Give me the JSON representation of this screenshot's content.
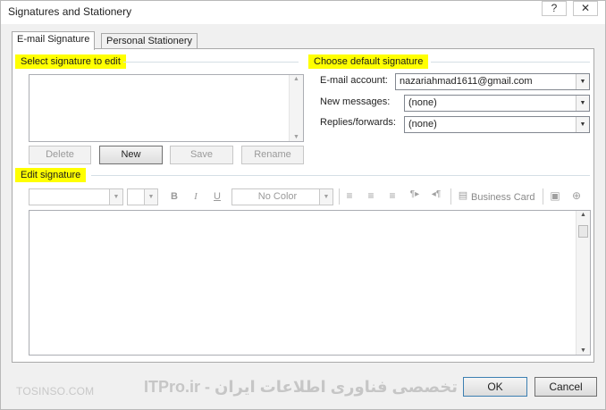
{
  "window": {
    "title": "Signatures and Stationery",
    "help_glyph": "?",
    "close_glyph": "✕"
  },
  "tabs": [
    {
      "label": "E-mail Signature",
      "active": true
    },
    {
      "label": "Personal Stationery",
      "active": false
    }
  ],
  "select_section": {
    "heading": "Select signature to edit",
    "buttons": {
      "delete": "Delete",
      "new": "New",
      "save": "Save",
      "rename": "Rename"
    }
  },
  "default_section": {
    "heading": "Choose default signature",
    "email_account_label": "E-mail account:",
    "email_account_value": "nazariahmad1611@gmail.com",
    "new_messages_label": "New messages:",
    "new_messages_value": "(none)",
    "replies_label": "Replies/forwards:",
    "replies_value": "(none)"
  },
  "edit_section": {
    "heading": "Edit signature",
    "toolbar": {
      "bold": "B",
      "italic": "I",
      "underline": "U",
      "color_value": "No Color",
      "business_card": "Business Card",
      "icons": [
        "align-left-icon",
        "align-center-icon",
        "align-right-icon",
        "ltr-icon",
        "rtl-icon",
        "business-card-icon",
        "insert-picture-icon",
        "insert-hyperlink-icon"
      ]
    }
  },
  "footer": {
    "watermark_left": "TOSINSO.COM",
    "watermark_center": "ITPro.ir - انجمن تخصصی فناوری اطلاعات ایران",
    "ok": "OK",
    "cancel": "Cancel"
  },
  "colors": {
    "highlight": "#ffff00",
    "ok_border": "#3c7fb1"
  }
}
